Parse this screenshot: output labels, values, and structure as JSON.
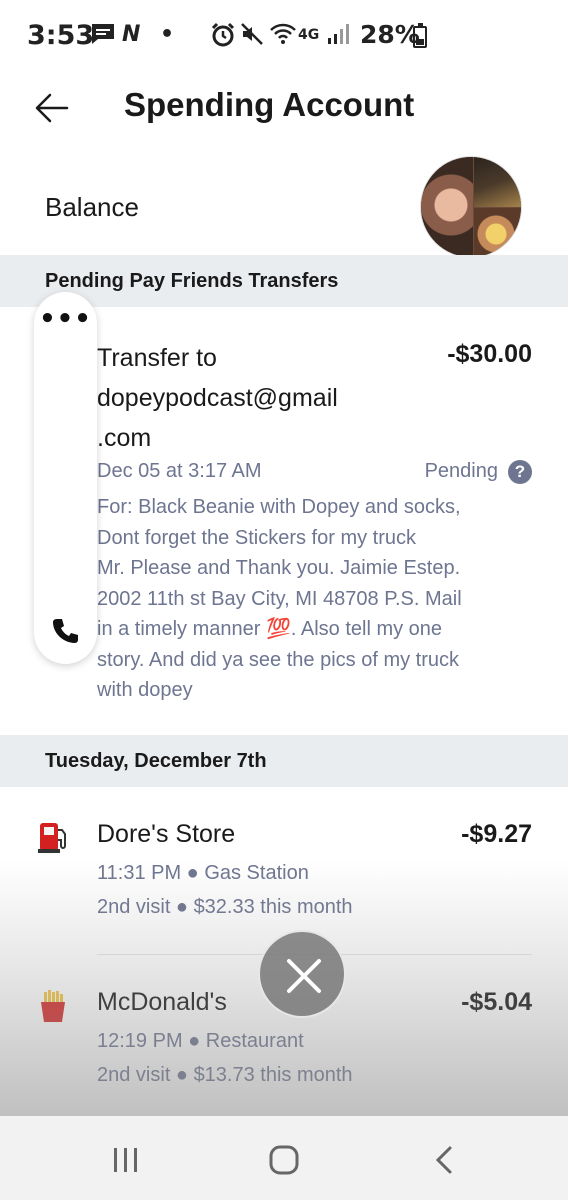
{
  "status_bar": {
    "time": "3:53",
    "battery": "28%",
    "network": "4G"
  },
  "header": {
    "title": "Spending Account"
  },
  "balance": {
    "label": "Balance"
  },
  "pending_section": {
    "header": "Pending Pay Friends Transfers",
    "transfer": {
      "title": "Transfer to dopeypodcast@gmail .com",
      "amount": "-$30.00",
      "date": "Dec 05 at 3:17 AM",
      "status": "Pending",
      "memo": "For: Black Beanie with Dopey and socks,\nDont forget the Stickers for my truck\nMr. Please and Thank you.  Jaimie Estep.\n2002 11th st Bay City, MI 48708 P.S.   Mail\nin a timely manner 💯. Also tell my one\nstory. And did ya see the pics of my truck\nwith dopey"
    }
  },
  "day_section": {
    "header": "Tuesday, December 7th",
    "transactions": [
      {
        "icon": "fuel-pump-icon",
        "name": "Dore's Store",
        "amount": "-$9.27",
        "time_category": "11:31 PM ● Gas Station",
        "visit_info": "2nd visit ● $32.33 this month"
      },
      {
        "icon": "fries-icon",
        "name": "McDonald's",
        "amount": "-$5.04",
        "time_category": "12:19 PM ● Restaurant",
        "visit_info": "2nd visit ● $13.73 this month"
      }
    ]
  },
  "colors": {
    "muted_text": "#6e7590",
    "section_bg": "#eaedf0"
  }
}
